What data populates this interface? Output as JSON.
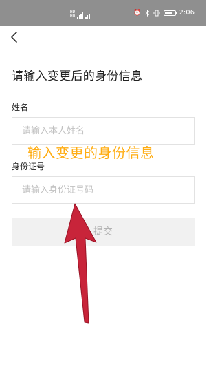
{
  "status_bar": {
    "sim_labels": [
      "HD",
      "HD"
    ],
    "time": "2:06",
    "icons": [
      "sim-signal-icon",
      "alarm-icon",
      "bluetooth-icon",
      "vibrate-icon",
      "battery-icon"
    ]
  },
  "header": {
    "back_icon": "chevron-left-icon"
  },
  "form": {
    "title": "请输入变更后的身份信息",
    "name_label": "姓名",
    "name_placeholder": "请输入本人姓名",
    "name_value": "",
    "id_label": "身份证号",
    "id_placeholder": "请输入身份证号码",
    "id_value": "",
    "submit_label": "提交"
  },
  "annotation": {
    "text": "输入变更的身份信息",
    "text_color": "#ffad12",
    "arrow_color": "#c8243a"
  }
}
